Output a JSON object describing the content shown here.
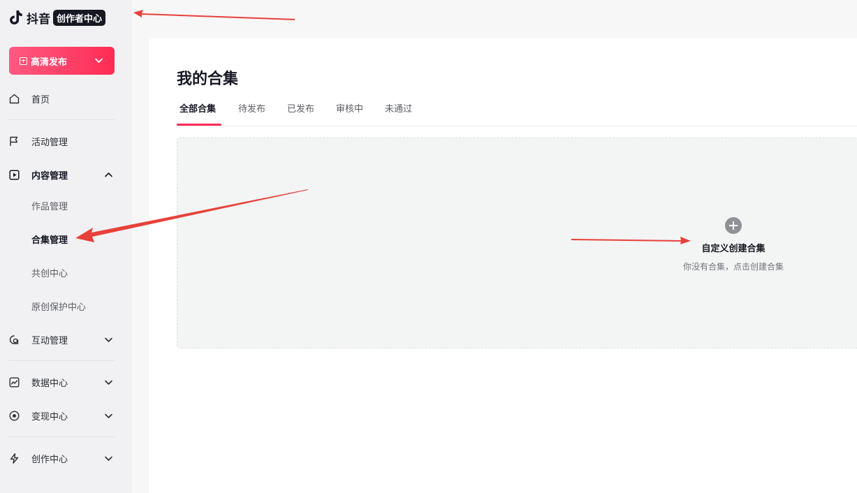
{
  "brand": {
    "name": "抖音",
    "badge": "创作者中心"
  },
  "sidebar": {
    "publish_label": "高清发布",
    "items": [
      {
        "label": "首页",
        "icon": "home-icon"
      },
      {
        "label": "活动管理",
        "icon": "flag-icon"
      },
      {
        "label": "内容管理",
        "icon": "play-square-icon",
        "expanded": true
      },
      {
        "label": "互动管理",
        "icon": "chat-icon"
      },
      {
        "label": "数据中心",
        "icon": "chart-icon"
      },
      {
        "label": "变现中心",
        "icon": "coin-icon"
      },
      {
        "label": "创作中心",
        "icon": "lightning-icon"
      }
    ],
    "content_sub_items": [
      {
        "label": "作品管理"
      },
      {
        "label": "合集管理",
        "active": true
      },
      {
        "label": "共创中心"
      },
      {
        "label": "原创保护中心"
      }
    ]
  },
  "main": {
    "title": "我的合集",
    "tabs": [
      {
        "label": "全部合集",
        "active": true
      },
      {
        "label": "待发布"
      },
      {
        "label": "已发布"
      },
      {
        "label": "审核中"
      },
      {
        "label": "未通过"
      }
    ],
    "empty_state": {
      "title": "自定义创建合集",
      "subtitle": "你没有合集，点击创建合集"
    }
  },
  "colors": {
    "accent": "#fe2c55",
    "annotation_arrow": "#e8403a"
  }
}
